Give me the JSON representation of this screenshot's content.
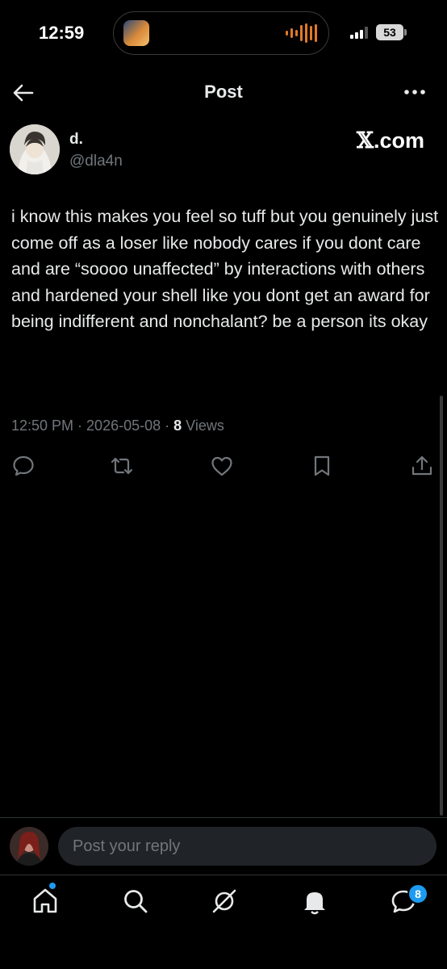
{
  "status_bar": {
    "time": "12:59",
    "battery": "53"
  },
  "header": {
    "title": "Post"
  },
  "author": {
    "name": "d.",
    "handle": "@dla4n"
  },
  "brand": {
    "x": "𝕏",
    "suffix": ".com"
  },
  "post": {
    "text": "i know this makes you feel so tuff but you genuinely just come off as a loser like nobody cares if you dont care and are “soooo unaffected” by interactions with others and hardened your shell like you dont get an award for being indifferent and nonchalant? be a person its okay",
    "time": "12:50 PM",
    "date": "2026-05-08",
    "sep": " · ",
    "views_count": "8",
    "views_label": "Views"
  },
  "actions": [
    "reply-icon",
    "repost-icon",
    "like-icon",
    "bookmark-icon",
    "share-icon"
  ],
  "reply": {
    "placeholder": "Post your reply"
  },
  "bottom_nav": {
    "items": [
      "home-icon",
      "search-icon",
      "grok-icon",
      "notifications-icon",
      "messages-icon"
    ],
    "messages_badge": "8"
  },
  "colors": {
    "background": "#000000",
    "text": "#e7e9ea",
    "muted": "#71767b",
    "accent": "#1d9bf0"
  }
}
